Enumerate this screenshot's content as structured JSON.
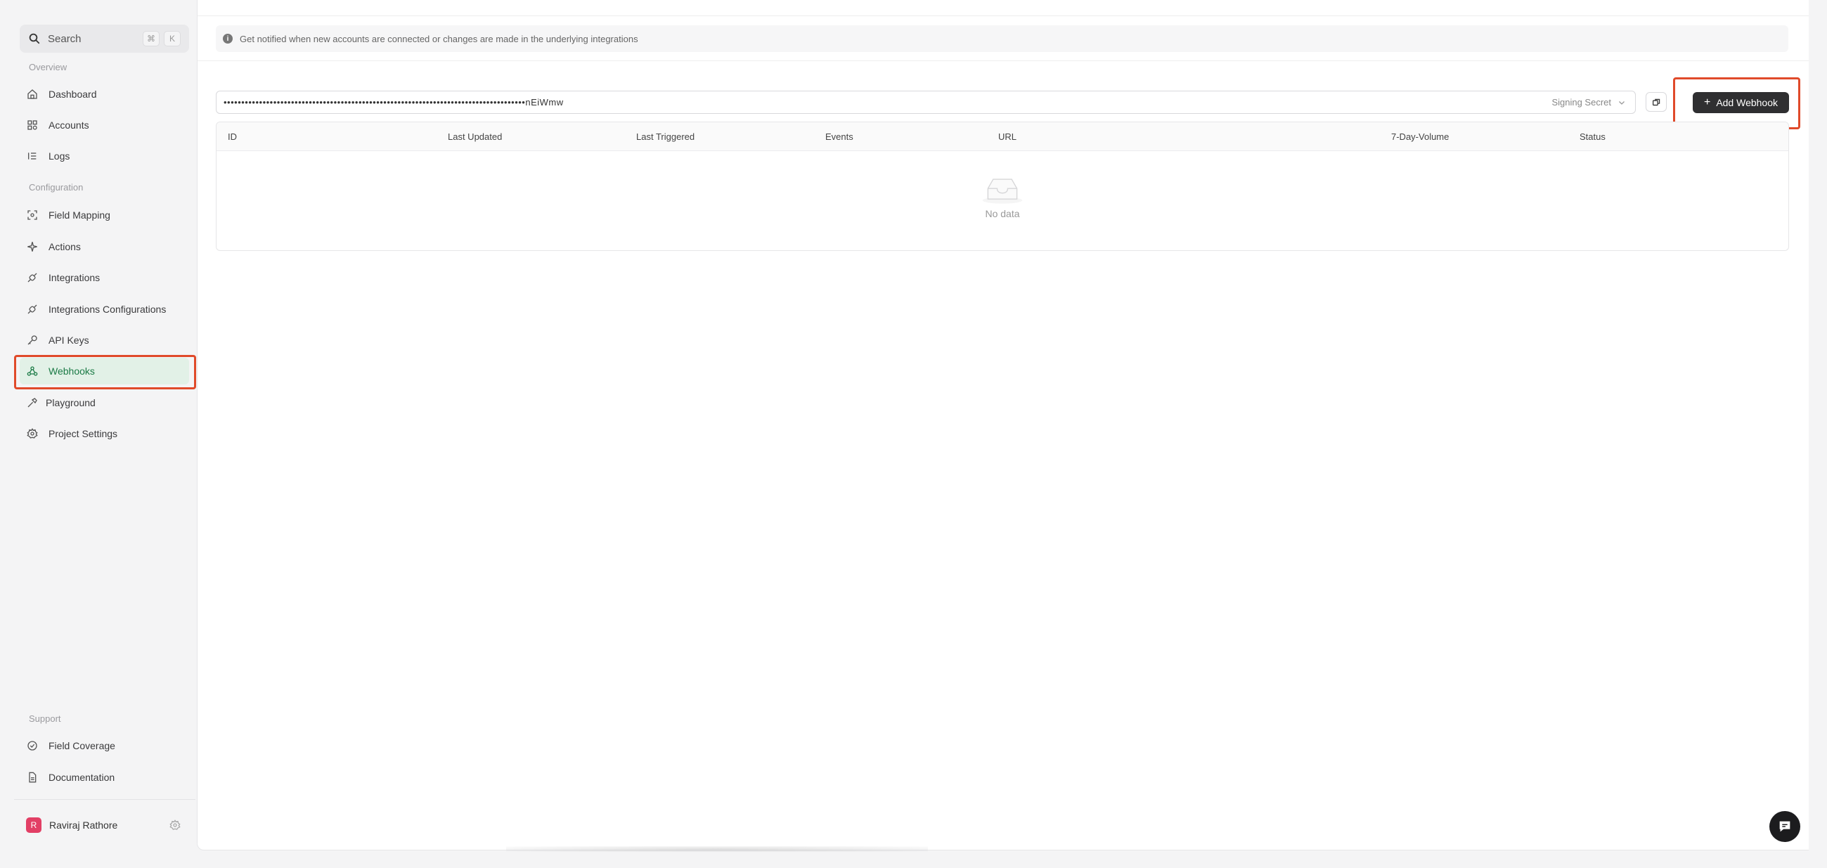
{
  "sidebar": {
    "search": {
      "label": "Search",
      "shortcut": [
        "⌘",
        "K"
      ]
    },
    "sections": {
      "overview": "Overview",
      "configuration": "Configuration",
      "support": "Support"
    },
    "items": [
      {
        "label": "Dashboard",
        "icon": "home-icon"
      },
      {
        "label": "Accounts",
        "icon": "grid-icon"
      },
      {
        "label": "Logs",
        "icon": "list-icon"
      },
      {
        "label": "Field Mapping",
        "icon": "scan-icon"
      },
      {
        "label": "Actions",
        "icon": "sparkle-icon"
      },
      {
        "label": "Integrations",
        "icon": "plug-icon"
      },
      {
        "label": "Integrations Configurations",
        "icon": "plug-icon"
      },
      {
        "label": "API Keys",
        "icon": "key-icon"
      },
      {
        "label": "Webhooks",
        "icon": "webhook-icon",
        "active": true
      },
      {
        "label": "Playground",
        "icon": "hammer-icon"
      },
      {
        "label": "Project Settings",
        "icon": "gear-icon"
      },
      {
        "label": "Field Coverage",
        "icon": "check-circle-icon"
      },
      {
        "label": "Documentation",
        "icon": "document-icon"
      }
    ],
    "user": {
      "initial": "R",
      "name": "Raviraj Rathore"
    }
  },
  "main": {
    "banner": "Get notified when new accounts are connected or changes are made in the underlying integrations",
    "secret": {
      "value": "•••••••••••••••••••••••••••••••••••••••••••••••••••••••••••••••••••••••••••••••••••••nEiWmw",
      "selected": "Signing Secret"
    },
    "add_button": "Add Webhook",
    "table": {
      "columns": [
        "ID",
        "Last Updated",
        "Last Triggered",
        "Events",
        "URL",
        "7-Day-Volume",
        "Status"
      ],
      "empty_text": "No data"
    }
  },
  "colors": {
    "accent": "#1a7a45",
    "active_bg": "#e2f1e7",
    "highlight": "#e04a2a",
    "button": "#2f2f31",
    "avatar": "#e23f65"
  }
}
